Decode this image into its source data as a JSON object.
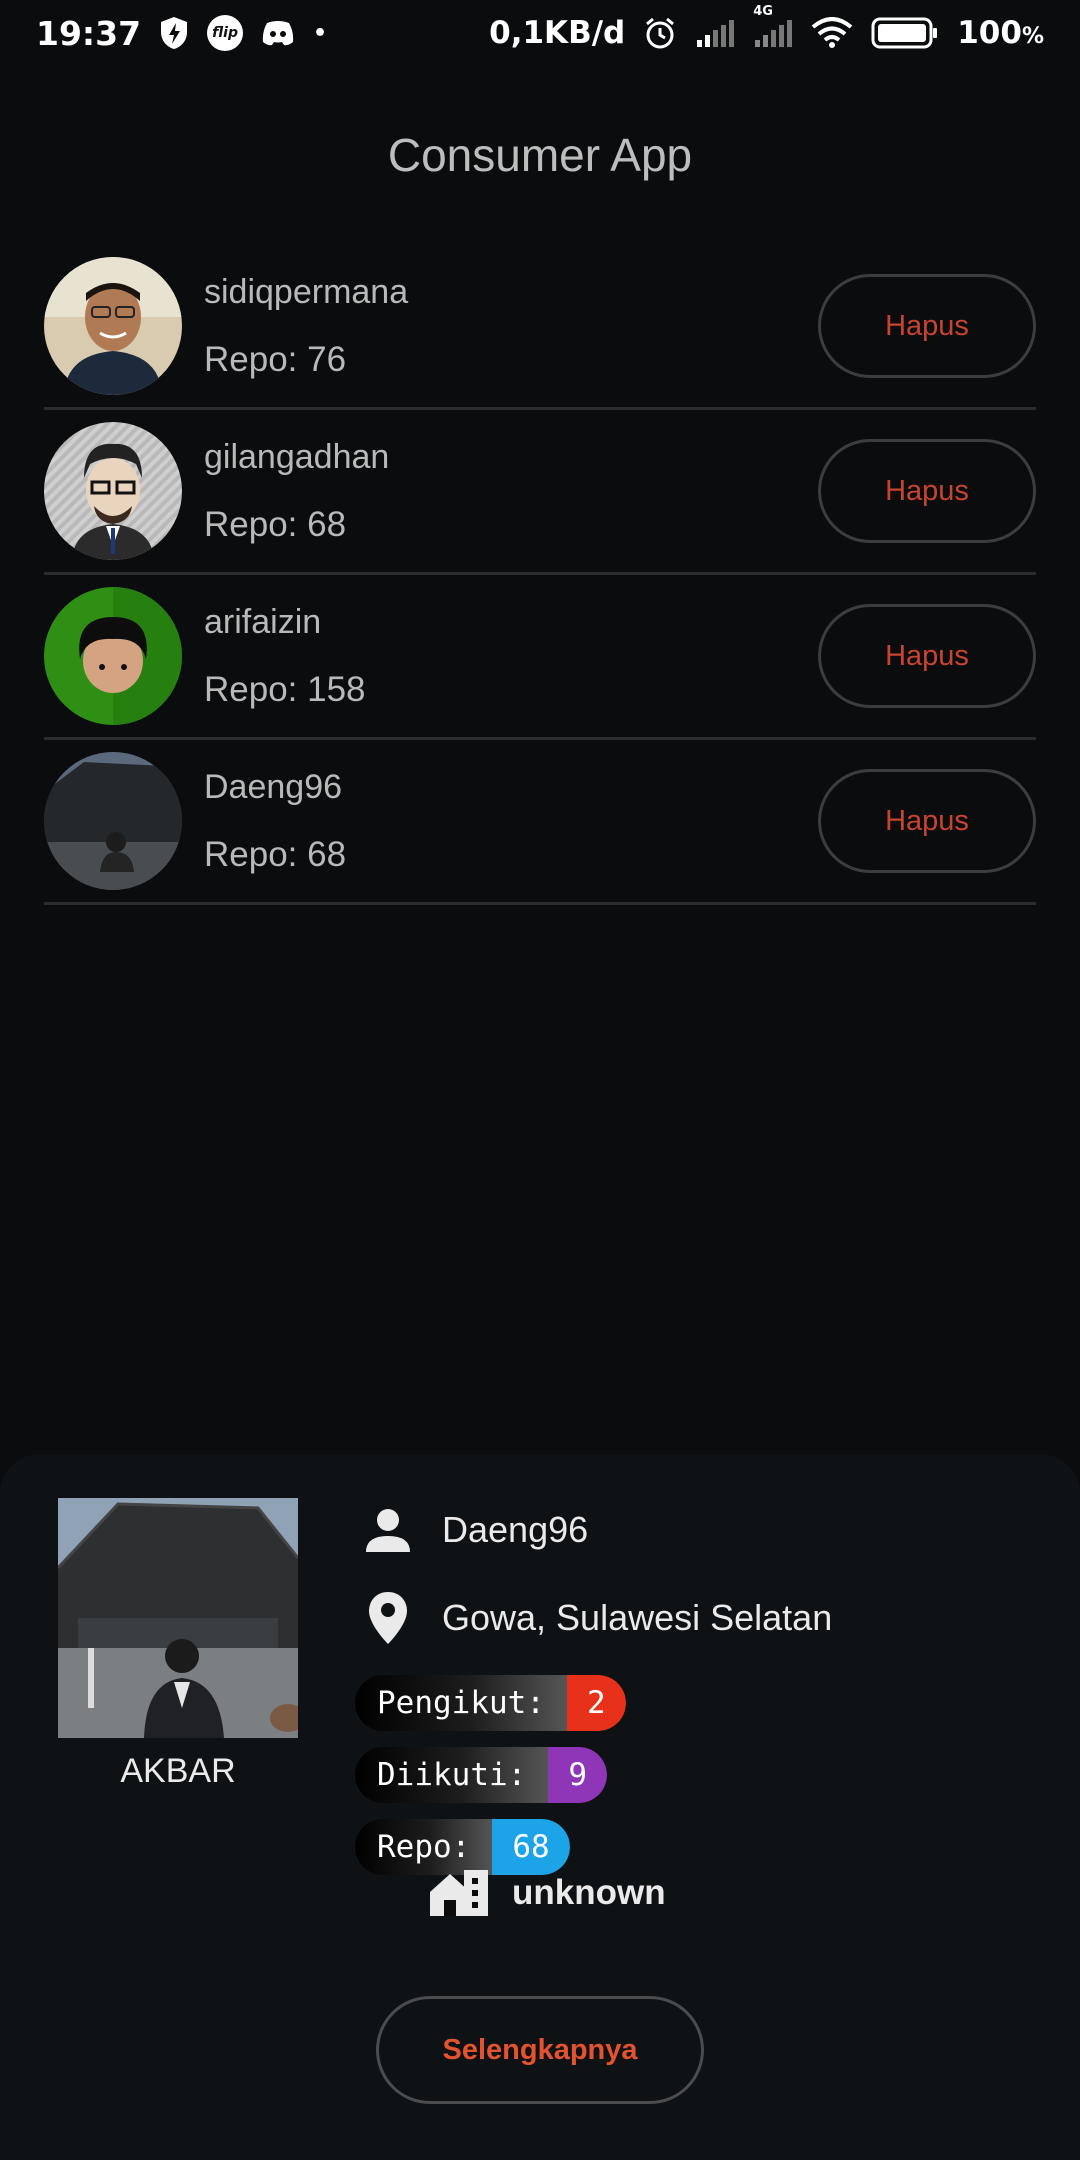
{
  "status_bar": {
    "time": "19:37",
    "flip_badge": "flip",
    "dot": "•",
    "net_speed": "0,1KB/d",
    "network_type": "4G",
    "battery_pct": "100",
    "battery_unit": "%",
    "icons": [
      "shield-bolt-icon",
      "flip-icon",
      "discord-icon",
      "alarm-icon",
      "signal-icon",
      "wifi-icon",
      "battery-icon"
    ]
  },
  "app": {
    "title": "Consumer App"
  },
  "users": [
    {
      "username": "sidiqpermana",
      "repo": "Repo: 76",
      "button": "Hapus"
    },
    {
      "username": "gilangadhan",
      "repo": "Repo: 68",
      "button": "Hapus"
    },
    {
      "username": "arifaizin",
      "repo": "Repo: 158",
      "button": "Hapus"
    },
    {
      "username": "Daeng96",
      "repo": "Repo: 68",
      "button": "Hapus"
    }
  ],
  "detail": {
    "name": "AKBAR",
    "username": "Daeng96",
    "location": "Gowa, Sulawesi Selatan",
    "followers_label": "Pengikut:",
    "followers": "2",
    "following_label": "Diikuti:",
    "following": "9",
    "repo_label": "Repo:",
    "repo": "68",
    "company": "unknown",
    "more_button": "Selengkapnya",
    "colors": {
      "followers": "#e8311a",
      "following": "#8e35b8",
      "repo": "#1da3e8",
      "accent": "#e4532f"
    }
  }
}
